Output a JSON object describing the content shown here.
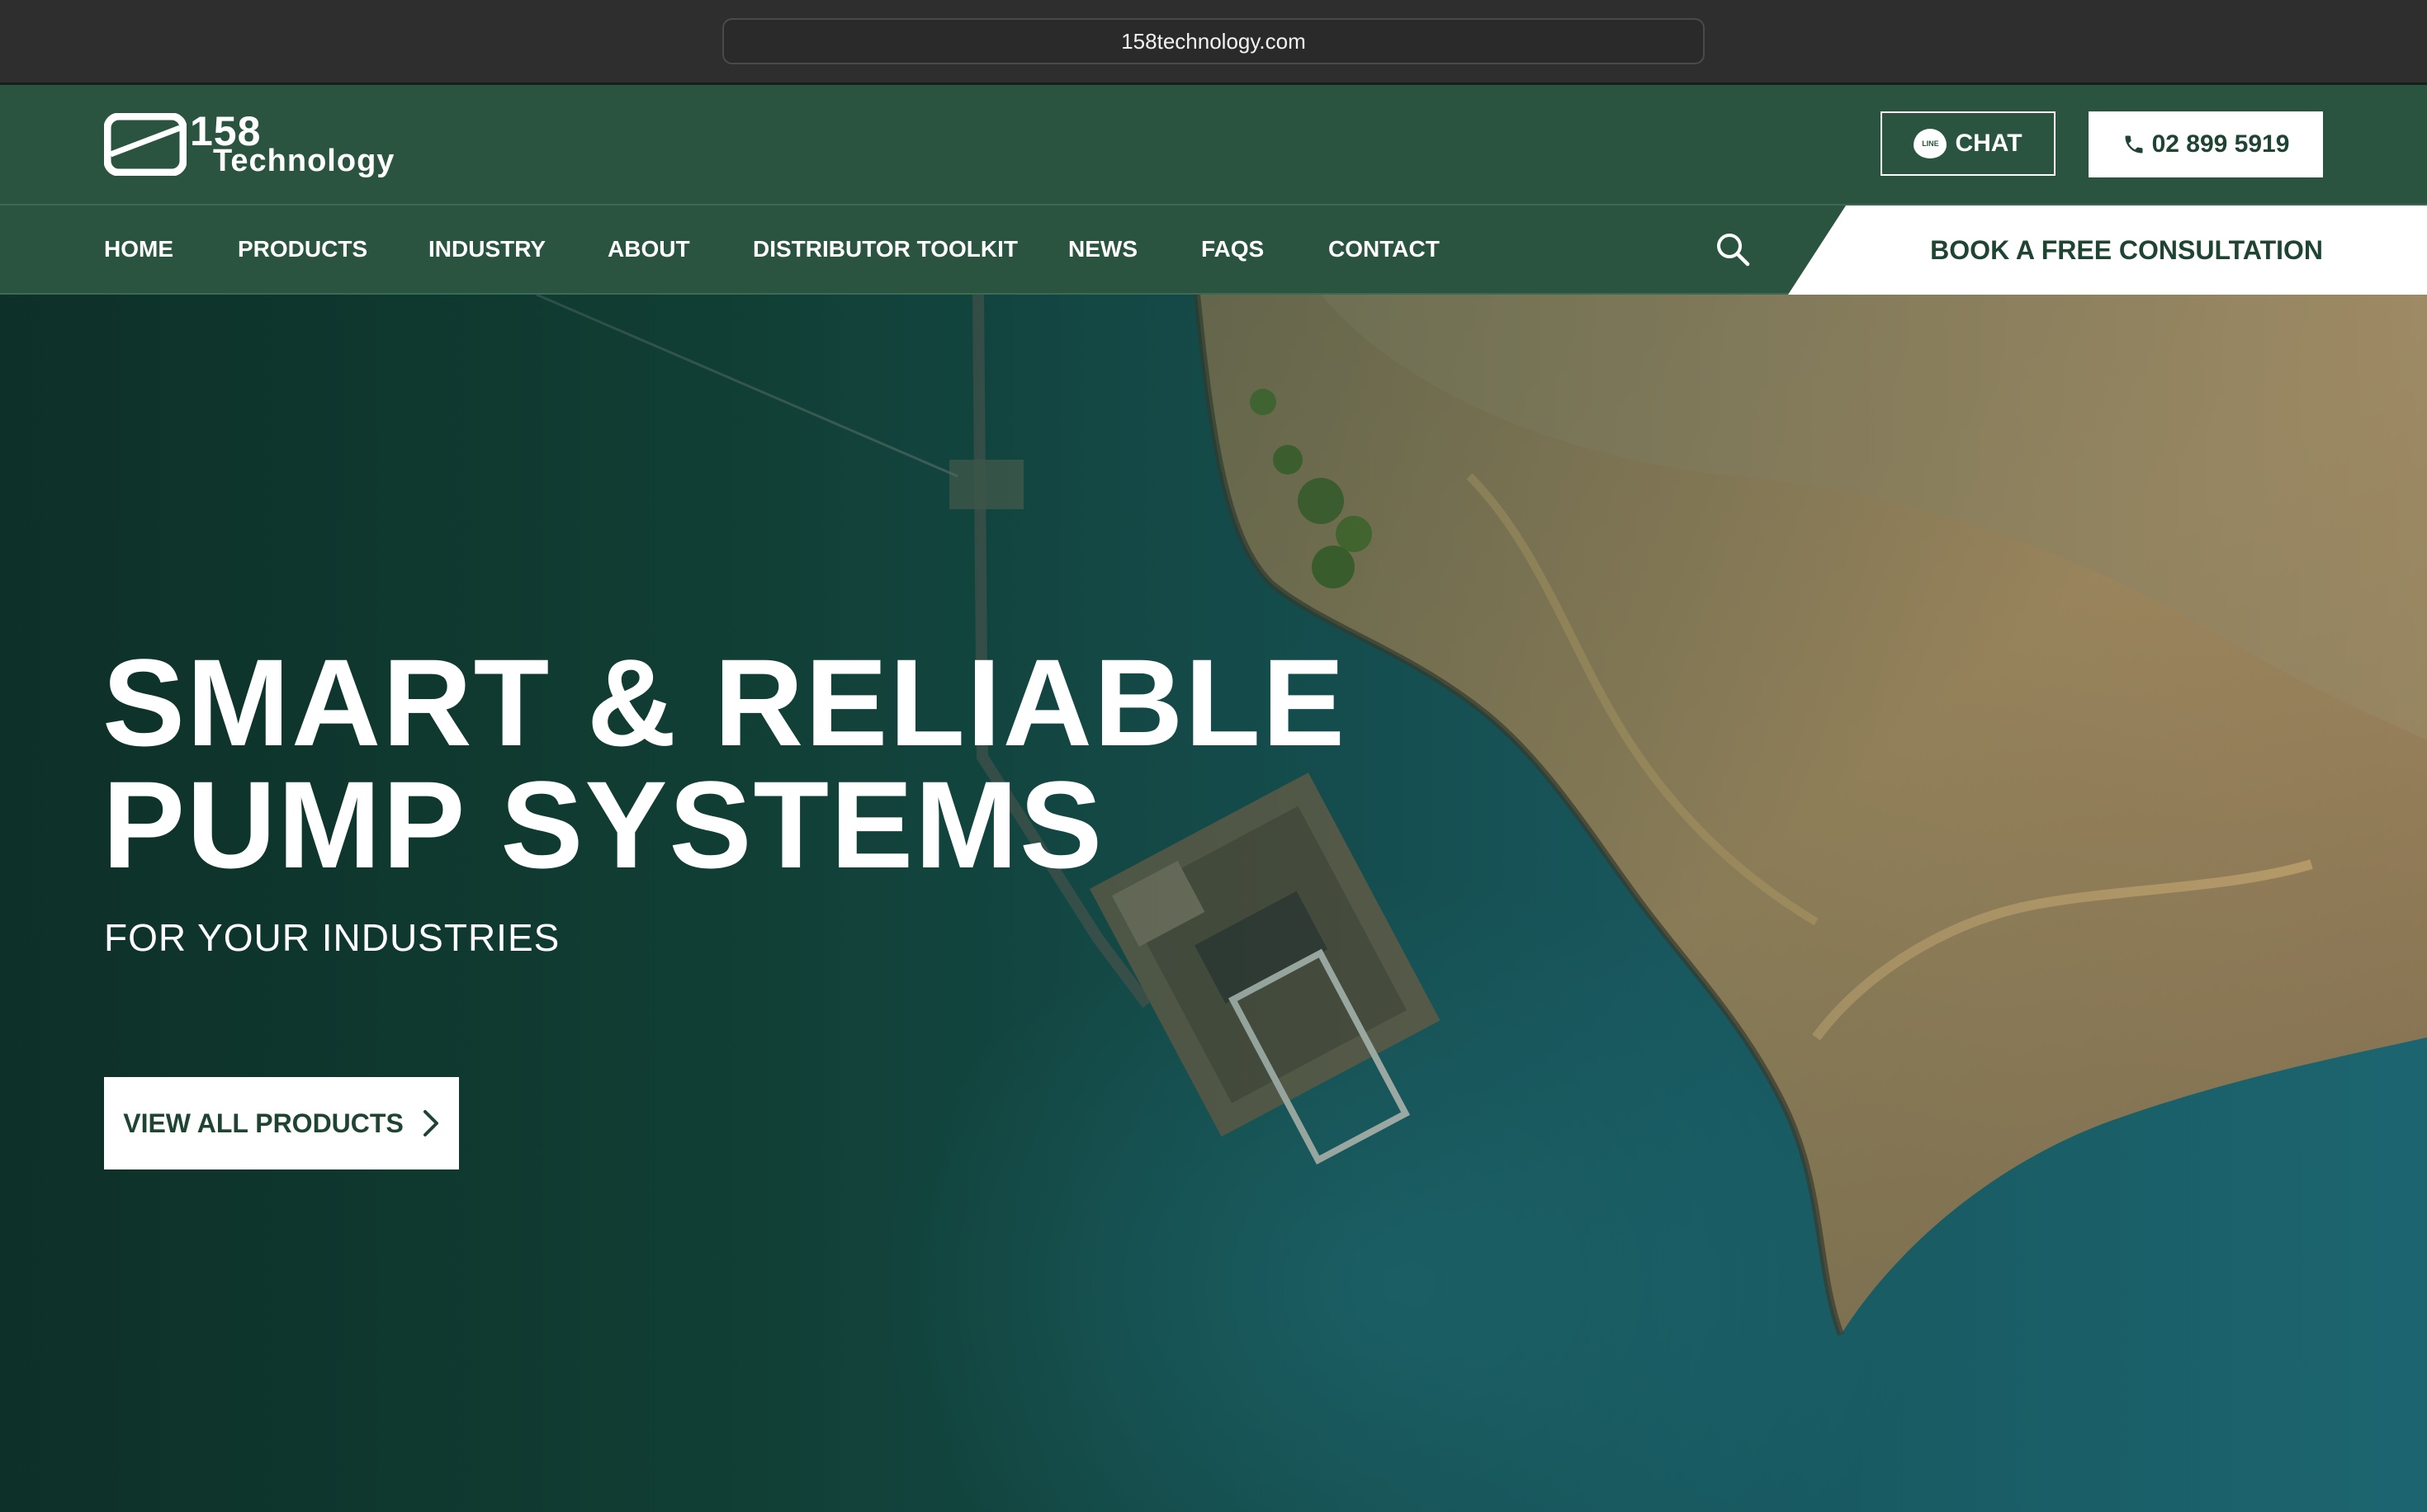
{
  "browser": {
    "url": "158technology.com"
  },
  "header": {
    "logo": {
      "number": "158",
      "word": "Technology"
    },
    "chat": {
      "icon": "line-chat-icon",
      "icon_text": "LINE",
      "label": "CHAT"
    },
    "phone": {
      "icon": "phone-icon",
      "label": "02 899 5919"
    }
  },
  "nav": {
    "items": [
      "HOME",
      "PRODUCTS",
      "INDUSTRY",
      "ABOUT",
      "DISTRIBUTOR TOOLKIT",
      "NEWS",
      "FAQS",
      "CONTACT"
    ],
    "search_icon": "search-icon",
    "consult_label": "BOOK A FREE CONSULTATION"
  },
  "hero": {
    "title_line1": "SMART & RELIABLE",
    "title_line2": "PUMP SYSTEMS",
    "subtitle": "FOR YOUR INDUSTRIES",
    "cta_label": "VIEW ALL PRODUCTS",
    "cta_icon": "chevron-right-icon"
  },
  "colors": {
    "brand_green": "#2a5440",
    "dark_text_green": "#1f4434",
    "water_teal": "#1c6570",
    "land_sand": "#a58a60"
  }
}
